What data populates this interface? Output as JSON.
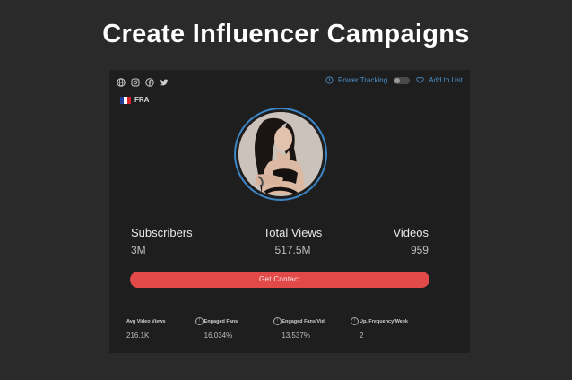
{
  "page_title": "Create Influencer Campaigns",
  "social_icons": [
    "globe-icon",
    "instagram-icon",
    "facebook-icon",
    "twitter-icon"
  ],
  "actions": {
    "power_tracking_label": "Power Tracking",
    "add_to_list_label": "Add to List",
    "power_tracking_on": false
  },
  "country": {
    "code": "FRA",
    "flag_colors": [
      "#1f3f9a",
      "#ffffff",
      "#d8232a"
    ]
  },
  "stats": {
    "subscribers": {
      "label": "Subscribers",
      "value": "3M"
    },
    "total_views": {
      "label": "Total Views",
      "value": "517.5M"
    },
    "videos": {
      "label": "Videos",
      "value": "959"
    }
  },
  "contact_button_label": "Get Contact",
  "metrics": [
    {
      "label": "Avg Video Views",
      "value": "216.1K"
    },
    {
      "label": "Engaged Fans",
      "value": "16.034%"
    },
    {
      "label": "Engaged Fans/Vid",
      "value": "13.537%"
    },
    {
      "label": "Up. Frequency/Week",
      "value": "2"
    }
  ],
  "colors": {
    "accent_blue": "#3d86c6",
    "button_red": "#e24a4a",
    "background": "#2a2a2b",
    "card": "#1e1e1f"
  }
}
